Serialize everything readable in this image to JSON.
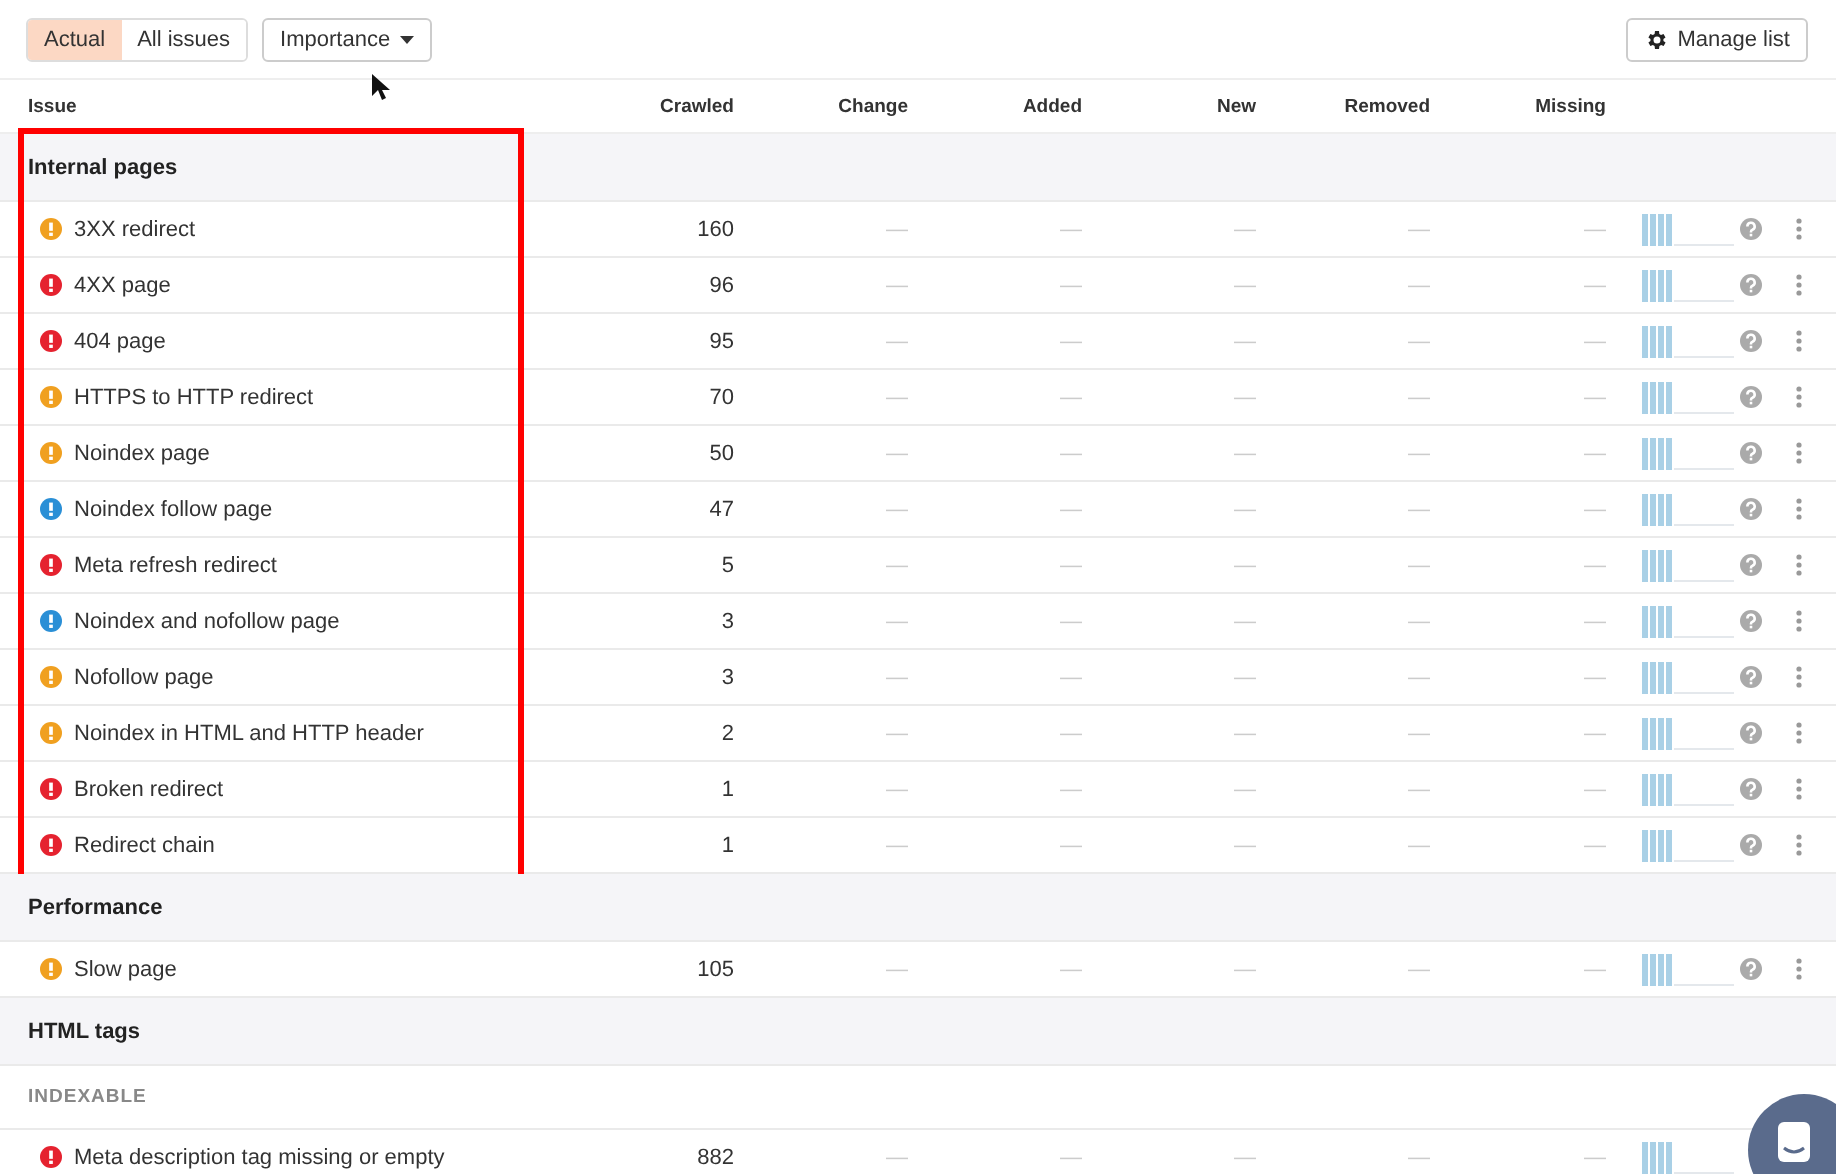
{
  "filters": [
    {
      "label": "Actual",
      "selected": true
    },
    {
      "label": "All issues",
      "selected": false
    }
  ],
  "sort_dropdown": {
    "label": "Importance"
  },
  "manage_button": {
    "label": "Manage list"
  },
  "columns": [
    "Issue",
    "Crawled",
    "Change",
    "Added",
    "New",
    "Removed",
    "Missing"
  ],
  "groups": [
    {
      "title": "Internal pages",
      "highlighted": true,
      "rows": [
        {
          "kind": "issue",
          "color": "#f0a020",
          "name": "3XX redirect",
          "crawled": "160",
          "cells": [
            "—",
            "—",
            "—",
            "—",
            "—"
          ],
          "show_actions": true
        },
        {
          "kind": "issue",
          "color": "#e5222f",
          "name": "4XX page",
          "crawled": "96",
          "cells": [
            "—",
            "—",
            "—",
            "—",
            "—"
          ],
          "show_actions": true
        },
        {
          "kind": "issue",
          "color": "#e5222f",
          "name": "404 page",
          "crawled": "95",
          "cells": [
            "—",
            "—",
            "—",
            "—",
            "—"
          ],
          "show_actions": true
        },
        {
          "kind": "issue",
          "color": "#f0a020",
          "name": "HTTPS to HTTP redirect",
          "crawled": "70",
          "cells": [
            "—",
            "—",
            "—",
            "—",
            "—"
          ],
          "show_actions": true
        },
        {
          "kind": "issue",
          "color": "#f0a020",
          "name": "Noindex page",
          "crawled": "50",
          "cells": [
            "—",
            "—",
            "—",
            "—",
            "—"
          ],
          "show_actions": true
        },
        {
          "kind": "issue",
          "color": "#2a8fd6",
          "name": "Noindex follow page",
          "crawled": "47",
          "cells": [
            "—",
            "—",
            "—",
            "—",
            "—"
          ],
          "show_actions": true
        },
        {
          "kind": "issue",
          "color": "#e5222f",
          "name": "Meta refresh redirect",
          "crawled": "5",
          "cells": [
            "—",
            "—",
            "—",
            "—",
            "—"
          ],
          "show_actions": true
        },
        {
          "kind": "issue",
          "color": "#2a8fd6",
          "name": "Noindex and nofollow page",
          "crawled": "3",
          "cells": [
            "—",
            "—",
            "—",
            "—",
            "—"
          ],
          "show_actions": true
        },
        {
          "kind": "issue",
          "color": "#f0a020",
          "name": "Nofollow page",
          "crawled": "3",
          "cells": [
            "—",
            "—",
            "—",
            "—",
            "—"
          ],
          "show_actions": true
        },
        {
          "kind": "issue",
          "color": "#f0a020",
          "name": "Noindex in HTML and HTTP header",
          "crawled": "2",
          "cells": [
            "—",
            "—",
            "—",
            "—",
            "—"
          ],
          "show_actions": true
        },
        {
          "kind": "issue",
          "color": "#e5222f",
          "name": "Broken redirect",
          "crawled": "1",
          "cells": [
            "—",
            "—",
            "—",
            "—",
            "—"
          ],
          "show_actions": true
        },
        {
          "kind": "issue",
          "color": "#e5222f",
          "name": "Redirect chain",
          "crawled": "1",
          "cells": [
            "—",
            "—",
            "—",
            "—",
            "—"
          ],
          "show_actions": true
        }
      ]
    },
    {
      "title": "Performance",
      "highlighted": false,
      "rows": [
        {
          "kind": "issue",
          "color": "#f0a020",
          "name": "Slow page",
          "crawled": "105",
          "cells": [
            "—",
            "—",
            "—",
            "—",
            "—"
          ],
          "show_actions": true
        }
      ]
    },
    {
      "title": "HTML tags",
      "highlighted": false,
      "rows": [
        {
          "kind": "subheading",
          "label": "INDEXABLE"
        },
        {
          "kind": "issue",
          "color": "#e5222f",
          "name": "Meta description tag missing or empty",
          "crawled": "882",
          "cells": [
            "—",
            "—",
            "—",
            "—",
            "—"
          ],
          "show_actions": false
        }
      ]
    }
  ]
}
